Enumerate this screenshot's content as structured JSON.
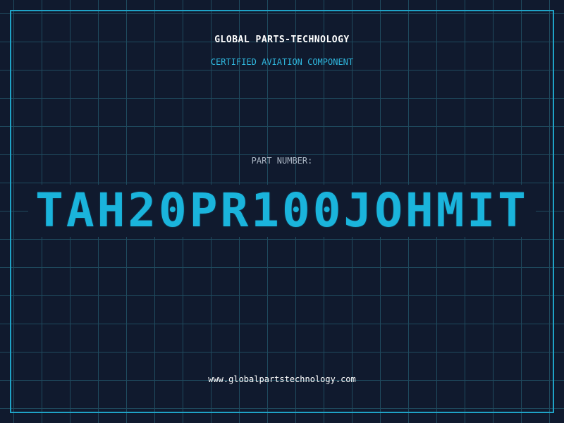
{
  "header": {
    "brand": "GLOBAL PARTS-TECHNOLOGY",
    "subtitle": "CERTIFIED AVIATION COMPONENT"
  },
  "part": {
    "label": "PART NUMBER:",
    "number": "TAH20PR100JOHMIT"
  },
  "footer": {
    "url": "www.globalpartstechnology.com"
  },
  "colors": {
    "background": "#101a2e",
    "grid": "#1f4a5e",
    "accent": "#1fa3c7",
    "part_number": "#1ab4dc",
    "label": "#aab5c3",
    "text": "#ffffff"
  }
}
